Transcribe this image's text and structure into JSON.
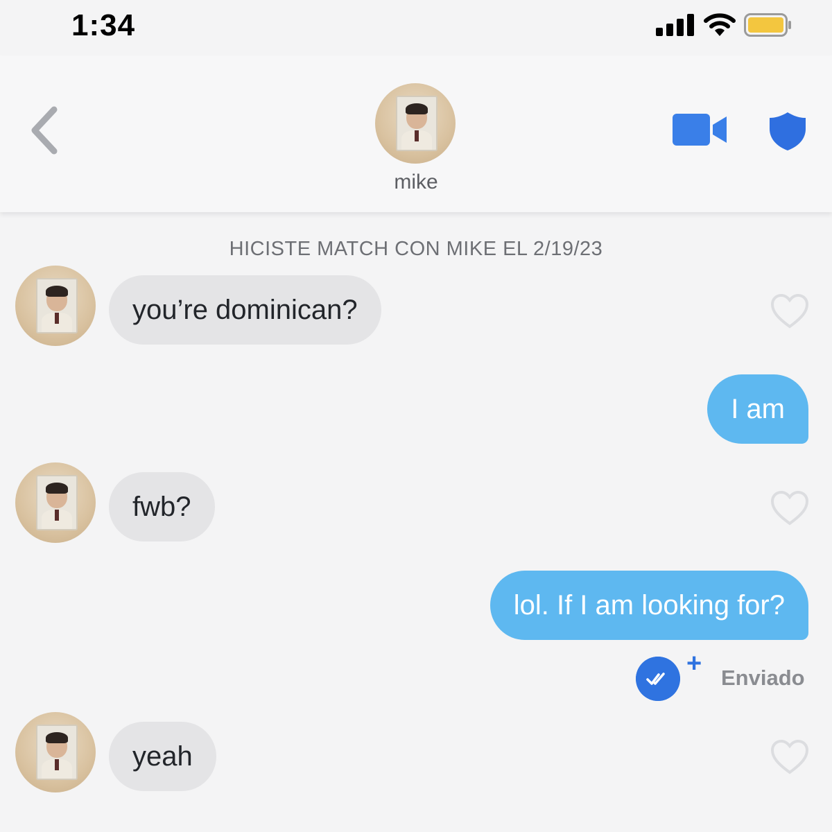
{
  "status_bar": {
    "time": "1:34"
  },
  "header": {
    "contact_name": "mike"
  },
  "match_banner": "HICISTE MATCH CON MIKE EL 2/19/23",
  "messages": [
    {
      "direction": "in",
      "text": "you’re dominican?"
    },
    {
      "direction": "out",
      "text": "I am"
    },
    {
      "direction": "in",
      "text": "fwb?"
    },
    {
      "direction": "out",
      "text": "lol. If I am looking for?"
    },
    {
      "direction": "in",
      "text": "yeah"
    }
  ],
  "sent_status": "Enviado",
  "colors": {
    "outgoing_bubble": "#5eb8f0",
    "incoming_bubble": "#e4e4e6",
    "accent_blue": "#2f73e0",
    "battery": "#f3c63f"
  },
  "icons": [
    "back-chevron-icon",
    "video-call-icon",
    "shield-icon",
    "heart-icon",
    "double-check-icon",
    "plus-icon",
    "signal-icon",
    "wifi-icon",
    "battery-icon"
  ]
}
